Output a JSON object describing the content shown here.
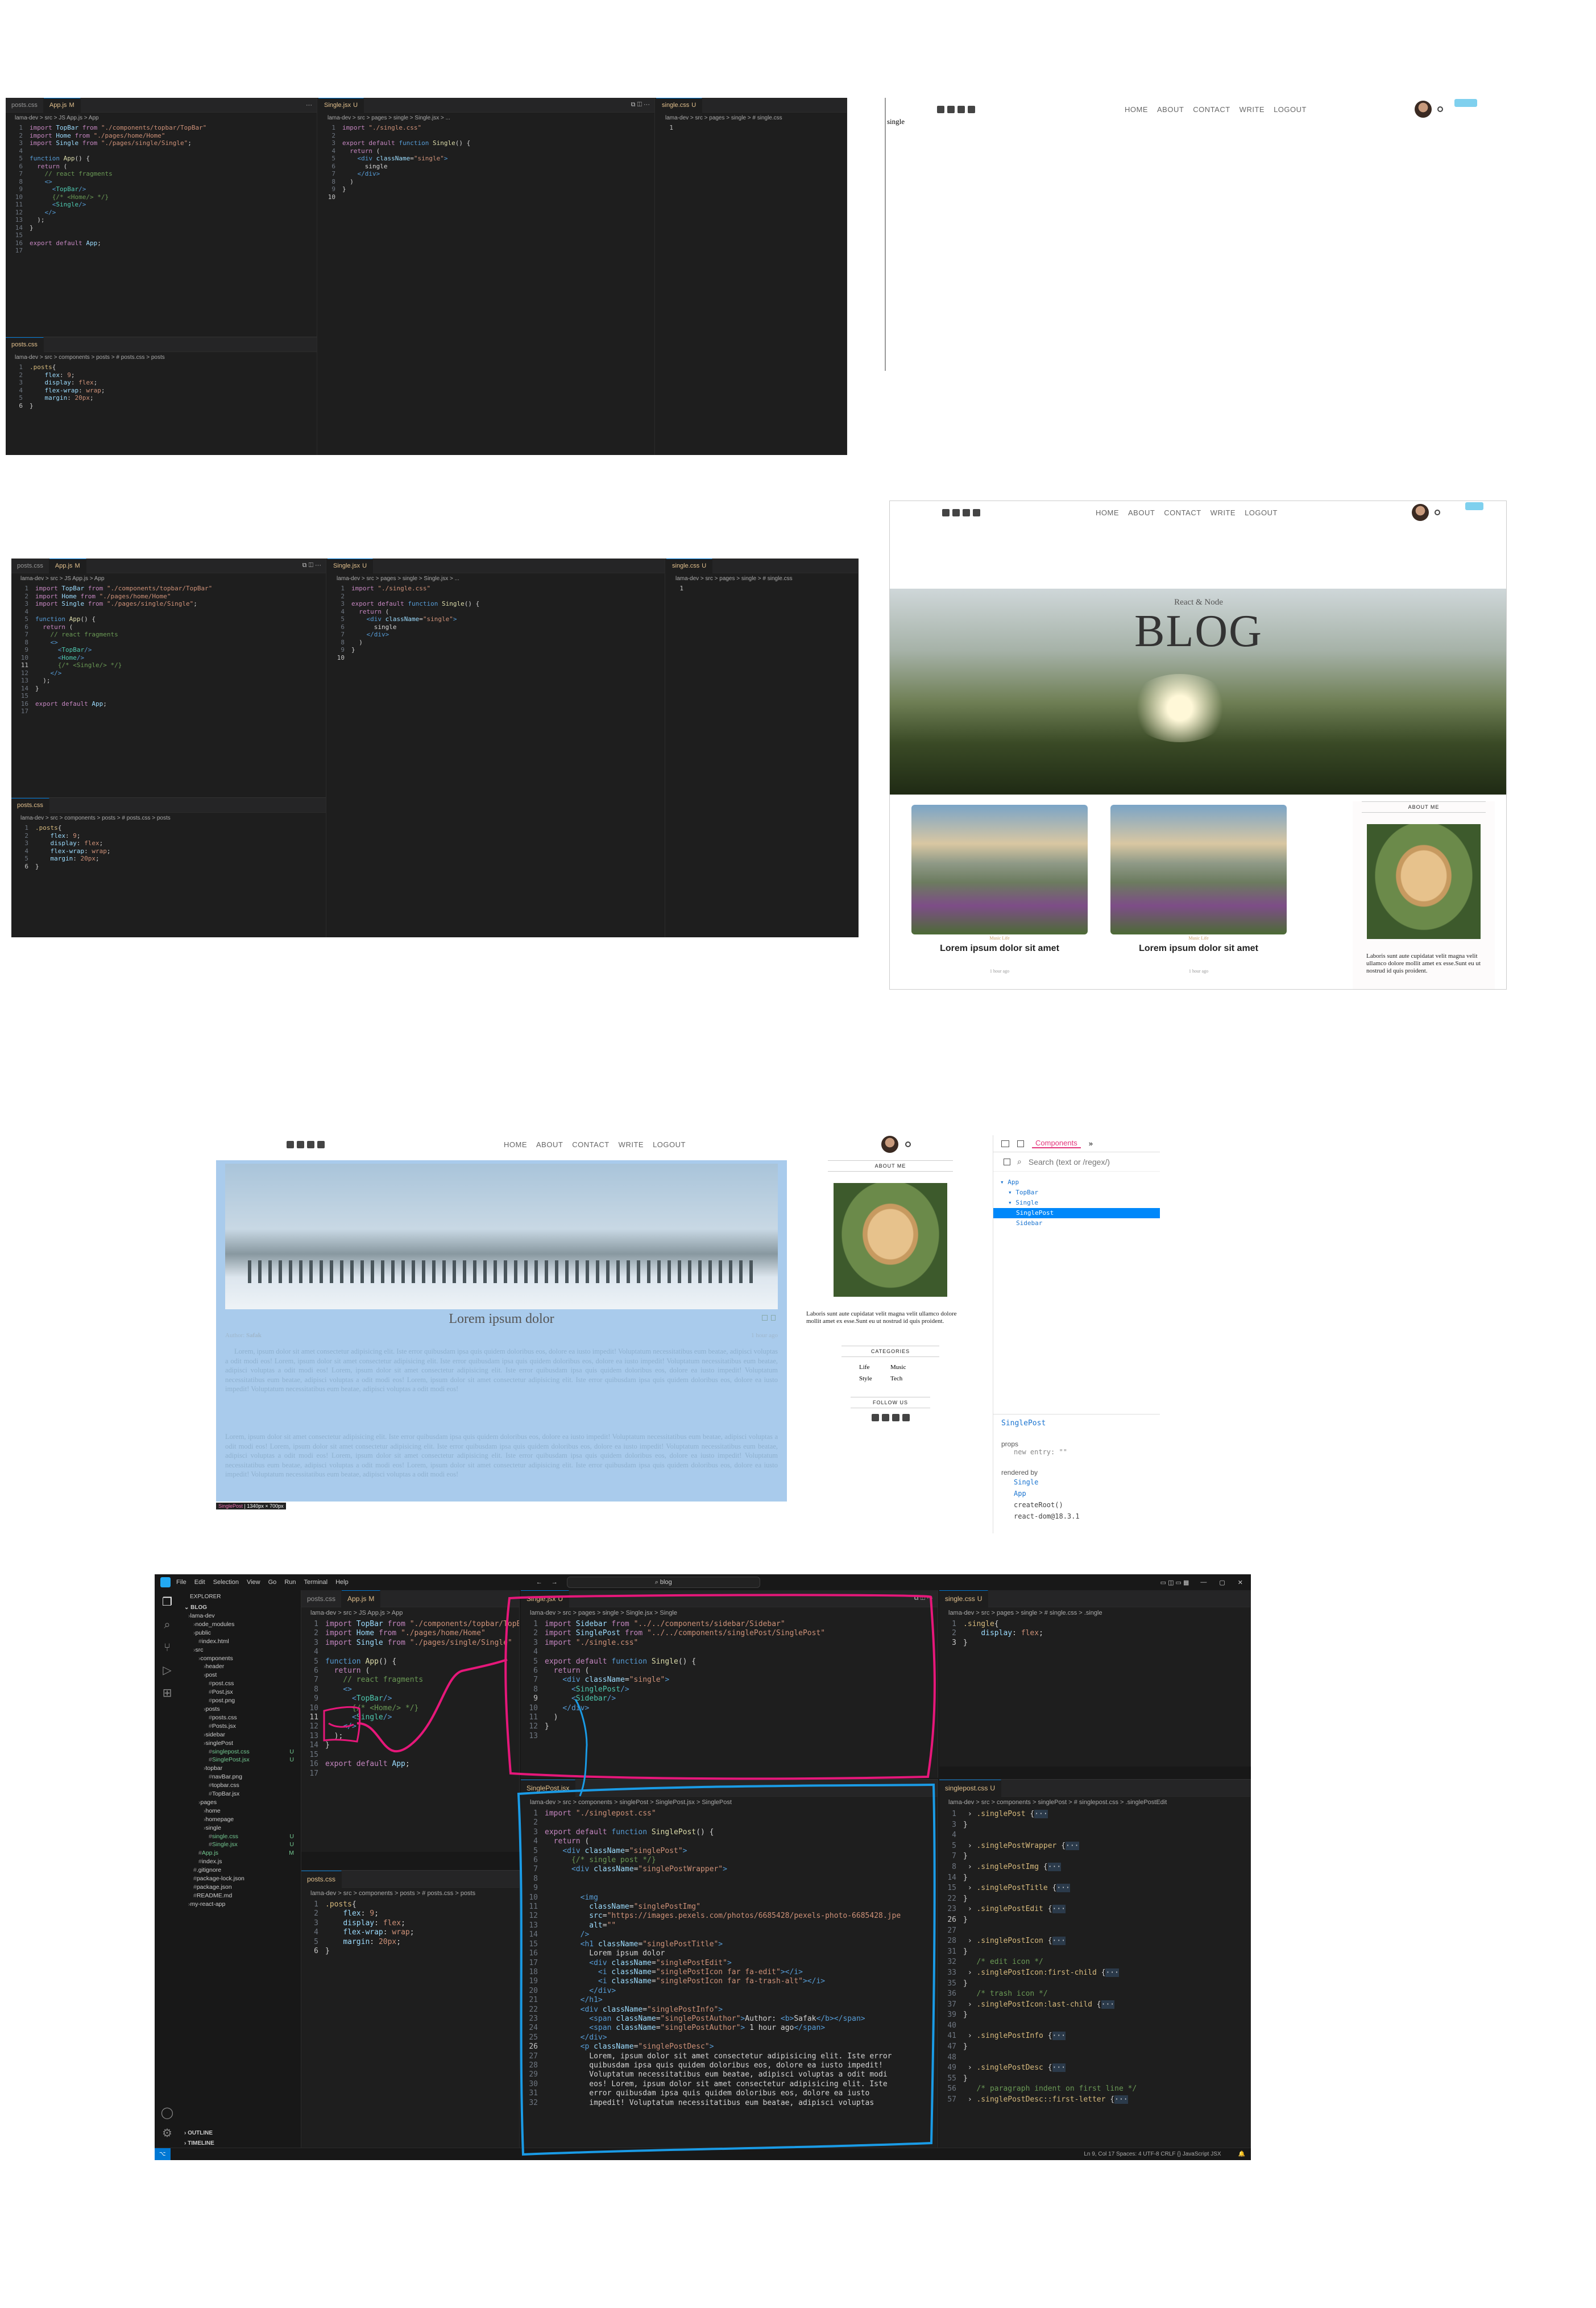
{
  "vscode": {
    "top_tabs": {
      "posts_css": "posts.css",
      "app_js": "App.js",
      "app_js_mod": "M",
      "single_jsx": "Single.jsx",
      "single_jsx_mod": "U",
      "single_css": "single.css",
      "single_css_mod": "U",
      "singlepost_jsx": "SinglePost.jsx",
      "singlepost_css": "singlepost.css"
    },
    "bc_app": "lama-dev > src > JS App.js > App",
    "bc_single_jsx": "lama-dev > src > pages > single > Single.jsx > ...",
    "bc_single_jsx_full": "lama-dev > src > pages > single > Single.jsx > Single",
    "bc_single_css": "lama-dev > src > pages > single > # single.css",
    "bc_single_css_sel": "lama-dev > src > pages > single > # single.css > .single",
    "bc_posts_css": "lama-dev > src > components > posts > # posts.css > posts",
    "bc_singlepost_jsx": "lama-dev > src > components > singlePost > SinglePost.jsx > SinglePost",
    "bc_singlepost_css": "lama-dev > src > components > singlePost > # singlepost.css > .singlePostEdit",
    "menubar": [
      "File",
      "Edit",
      "Selection",
      "View",
      "Go",
      "Run",
      "Terminal",
      "Help"
    ],
    "search": "blog",
    "explorer_title": "EXPLORER",
    "explorer_root": "BLOG",
    "tree": [
      {
        "t": "lama-dev",
        "d": 1,
        "k": "folder"
      },
      {
        "t": "node_modules",
        "d": 2,
        "k": "folder"
      },
      {
        "t": "public",
        "d": 2,
        "k": "folder"
      },
      {
        "t": "index.html",
        "d": 3,
        "k": "file"
      },
      {
        "t": "src",
        "d": 2,
        "k": "folder"
      },
      {
        "t": "components",
        "d": 3,
        "k": "folder"
      },
      {
        "t": "header",
        "d": 4,
        "k": "folder"
      },
      {
        "t": "post",
        "d": 4,
        "k": "folder"
      },
      {
        "t": "post.css",
        "d": 5,
        "k": "file"
      },
      {
        "t": "Post.jsx",
        "d": 5,
        "k": "file"
      },
      {
        "t": "post.png",
        "d": 5,
        "k": "file"
      },
      {
        "t": "posts",
        "d": 4,
        "k": "folder"
      },
      {
        "t": "posts.css",
        "d": 5,
        "k": "file"
      },
      {
        "t": "Posts.jsx",
        "d": 5,
        "k": "file"
      },
      {
        "t": "sidebar",
        "d": 4,
        "k": "folder"
      },
      {
        "t": "singlePost",
        "d": 4,
        "k": "folder"
      },
      {
        "t": "singlepost.css",
        "d": 5,
        "k": "file",
        "m": "U"
      },
      {
        "t": "SinglePost.jsx",
        "d": 5,
        "k": "file",
        "m": "U"
      },
      {
        "t": "topbar",
        "d": 4,
        "k": "folder"
      },
      {
        "t": "navBar.png",
        "d": 5,
        "k": "file"
      },
      {
        "t": "topbar.css",
        "d": 5,
        "k": "file"
      },
      {
        "t": "TopBar.jsx",
        "d": 5,
        "k": "file"
      },
      {
        "t": "pages",
        "d": 3,
        "k": "folder"
      },
      {
        "t": "home",
        "d": 4,
        "k": "folder"
      },
      {
        "t": "homepage",
        "d": 4,
        "k": "folder"
      },
      {
        "t": "single",
        "d": 4,
        "k": "folder"
      },
      {
        "t": "single.css",
        "d": 5,
        "k": "file",
        "m": "U"
      },
      {
        "t": "Single.jsx",
        "d": 5,
        "k": "file",
        "m": "U"
      },
      {
        "t": "App.js",
        "d": 3,
        "k": "file",
        "m": "M"
      },
      {
        "t": "index.js",
        "d": 3,
        "k": "file"
      },
      {
        "t": ".gitignore",
        "d": 2,
        "k": "file"
      },
      {
        "t": "package-lock.json",
        "d": 2,
        "k": "file"
      },
      {
        "t": "package.json",
        "d": 2,
        "k": "file"
      },
      {
        "t": "README.md",
        "d": 2,
        "k": "file"
      },
      {
        "t": "my-react-app",
        "d": 1,
        "k": "folder"
      }
    ],
    "outline": "OUTLINE",
    "timeline": "TIMELINE",
    "status": "Ln 9, Col 17   Spaces: 4   UTF-8   CRLF   {} JavaScript JSX"
  },
  "blog": {
    "menu": [
      "HOME",
      "ABOUT",
      "CONTACT",
      "WRITE",
      "LOGOUT"
    ],
    "single_text": "single",
    "header_small": "React & Node",
    "header_large": "BLOG",
    "post_title": "Lorem ipsum dolor sit amet",
    "post_cats": "Music   Life",
    "post_date": "1 hour ago",
    "about_me": "ABOUT ME",
    "about_text": "Laboris sunt aute cupidatat velit magna velit ullamco dolore mollit amet ex esse.Sunt eu ut nostrud id quis proident.",
    "categories": "CATEGORIES",
    "cats": [
      "Life",
      "Music",
      "Style",
      "Tech"
    ],
    "follow_us": "FOLLOW US",
    "single_title": "Lorem ipsum dolor",
    "author_label": "Author:",
    "author_name": "Safak",
    "single_date": "1 hour ago",
    "desc": "Lorem, ipsum dolor sit amet consectetur adipisicing elit. Iste error quibusdam ipsa quis quidem doloribus eos, dolore ea iusto impedit! Voluptatum necessitatibus eum beatae, adipisci voluptas a odit modi eos! Lorem, ipsum dolor sit amet consectetur adipisicing elit. Iste error quibusdam ipsa quis quidem doloribus eos, dolore ea iusto impedit! Voluptatum necessitatibus eum beatae, adipisci voluptas a odit modi eos! Lorem, ipsum dolor sit amet consectetur adipisicing elit. Iste error quibusdam ipsa quis quidem doloribus eos, dolore ea iusto impedit! Voluptatum necessitatibus eum beatae, adipisci voluptas a odit modi eos! Lorem, ipsum dolor sit amet consectetur adipisicing elit. Iste error quibusdam ipsa quis quidem doloribus eos, dolore ea iusto impedit! Voluptatum necessitatibus eum beatae, adipisci voluptas a odit modi eos!",
    "tooltip_name": "SinglePost",
    "tooltip_size": "1340px × 700px"
  },
  "devtools": {
    "tab": "Components",
    "search_placeholder": "Search (text or /regex/)",
    "tree": [
      {
        "t": "App",
        "d": 0
      },
      {
        "t": "TopBar",
        "d": 1
      },
      {
        "t": "Single",
        "d": 1
      },
      {
        "t": "SinglePost",
        "d": 2,
        "sel": true
      },
      {
        "t": "Sidebar",
        "d": 2
      }
    ],
    "selected": "SinglePost",
    "props": "props",
    "new_entry": "new entry: \"\"",
    "rendered_by": "rendered by",
    "rendered_list": [
      "Single",
      "App",
      "createRoot()",
      "react-dom@18.3.1"
    ]
  },
  "colors": {
    "annot_pink": "#e6177a",
    "annot_blue": "#1a9be6",
    "react_sel": "#0088fa"
  }
}
